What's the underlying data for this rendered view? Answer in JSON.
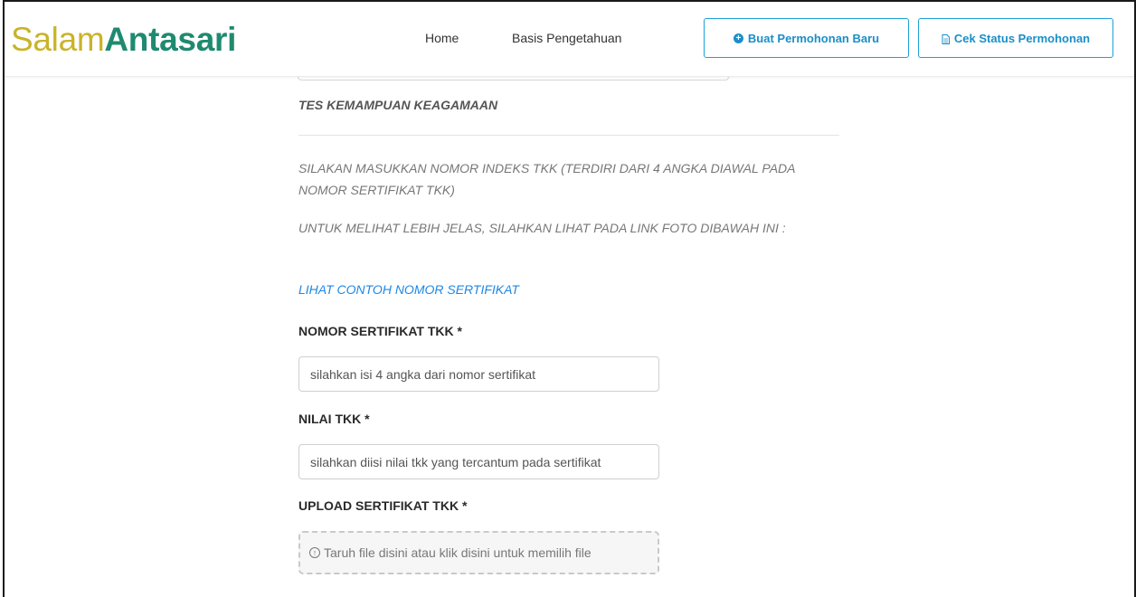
{
  "brand": {
    "part1": "Salam",
    "part2": "Antasari"
  },
  "nav": {
    "home": "Home",
    "basis": "Basis Pengetahuan",
    "new_request": "Buat Permohonan Baru",
    "check_status": "Cek Status Permohonan"
  },
  "colors": {
    "brand_gold": "#c9b32a",
    "brand_green": "#1f8a70",
    "accent_blue": "#1a8fc8",
    "link_blue": "#1e88e5"
  },
  "form": {
    "section_title": "TES KEMAMPUAN KEAGAMAAN",
    "help_1": "SILAKAN MASUKKAN NOMOR INDEKS TKK (TERDIRI DARI 4 ANGKA DIAWAL PADA NOMOR SERTIFIKAT TKK)",
    "help_2": "UNTUK MELIHAT LEBIH JELAS, SILAHKAN LIHAT PADA LINK FOTO DIBAWAH INI :",
    "example_link": "LIHAT CONTOH NOMOR SERTIFIKAT",
    "nomor_label": "NOMOR SERTIFIKAT TKK *",
    "nomor_placeholder": "silahkan isi 4 angka dari nomor sertifikat",
    "nilai_label": "NILAI TKK *",
    "nilai_placeholder": "silahkan diisi nilai tkk yang tercantum pada sertifikat",
    "upload_label": "UPLOAD SERTIFIKAT TKK *",
    "upload_hint": "Taruh file disini atau klik disini untuk memilih file"
  },
  "icons": {
    "plus": "plus-circle-icon",
    "doc": "document-icon",
    "upload": "upload-circle-icon"
  }
}
